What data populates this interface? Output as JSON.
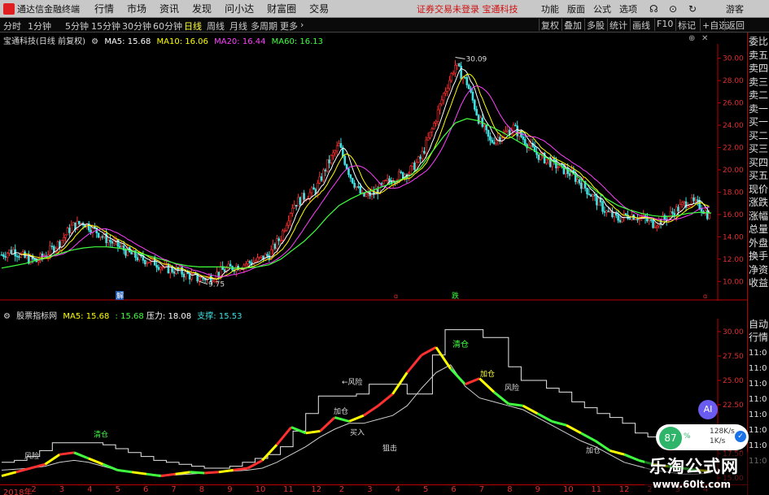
{
  "menubar": {
    "app_name": "通达信金融终端",
    "items": [
      "行情",
      "市场",
      "资讯",
      "发现",
      "问小达",
      "财富圈",
      "交易"
    ],
    "notice": "证券交易未登录  宝通科技",
    "right_items": [
      "功能",
      "版面",
      "公式",
      "选项"
    ],
    "guest": "游客"
  },
  "toolbar": {
    "periods": [
      "分时",
      "1分钟",
      "5分钟",
      "15分钟",
      "30分钟",
      "60分钟",
      "日线",
      "周线",
      "月线",
      "多周期",
      "更多"
    ],
    "active_period": "日线",
    "right_buttons": [
      "复权",
      "叠加",
      "多股",
      "统计",
      "画线",
      "F10",
      "标记",
      "+自选",
      "返回"
    ]
  },
  "main_chart": {
    "info": {
      "title": "宝通科技(日线 前复权)",
      "ma5": "MA5: 15.68",
      "ma10": "MA10: 16.06",
      "ma20": "MA20: 16.44",
      "ma60": "MA60: 16.13"
    },
    "high_label": "30.09",
    "low_label": "9.75",
    "markers": [
      "解",
      "跌"
    ],
    "colors": {
      "ma5": "#ffffff",
      "ma10": "#ffff00",
      "ma20": "#ff40ff",
      "ma60": "#40ff40",
      "up": "#ff3030",
      "down": "#40e0e0"
    }
  },
  "indicator": {
    "info": {
      "name": "股票指标网",
      "ma5": "MA5: 15.68",
      "ma5b": ": 15.68",
      "pressure": "压力: 18.08",
      "support": "支撑: 15.53"
    },
    "signals": [
      "风险",
      "清仓",
      "加仓",
      "买入",
      "狙击",
      "风险",
      "加仓"
    ]
  },
  "chart_data": [
    {
      "type": "line",
      "title": "宝通科技(日线 前复权)",
      "ylim": [
        9,
        31
      ],
      "y_ticks": [
        "30.00",
        "28.00",
        "26.00",
        "24.00",
        "22.00",
        "20.00",
        "18.00",
        "16.00",
        "14.00",
        "12.00",
        "10.00"
      ],
      "series": [
        {
          "name": "收盘",
          "values": [
            12.4,
            12.8,
            12.1,
            11.8,
            12.6,
            13.5,
            14.9,
            15.3,
            14.6,
            13.8,
            13.2,
            12.5,
            12.0,
            11.8,
            11.2,
            11.0,
            10.6,
            10.2,
            10.4,
            11.0,
            11.3,
            11.6,
            11.9,
            12.4,
            14.0,
            16.8,
            17.6,
            18.2,
            20.5,
            22.2,
            19.4,
            17.6,
            17.9,
            18.8,
            19.4,
            19.8,
            21.0,
            23.6,
            26.8,
            29.4,
            27.8,
            24.6,
            22.5,
            23.1,
            23.8,
            22.6,
            21.4,
            20.8,
            20.2,
            19.6,
            18.6,
            17.4,
            16.2,
            15.6,
            16.0,
            15.7,
            15.2,
            15.6,
            16.4,
            17.2,
            16.8,
            15.68
          ]
        },
        {
          "name": "MA60",
          "values": [
            11.2,
            11.4,
            11.6,
            11.9,
            12.2,
            12.5,
            12.8,
            13.0,
            13.1,
            13.1,
            13.0,
            12.8,
            12.5,
            12.2,
            11.9,
            11.6,
            11.4,
            11.3,
            11.3,
            11.3,
            11.2,
            11.2,
            11.3,
            11.5,
            12.0,
            12.8,
            13.6,
            14.6,
            15.8,
            16.8,
            17.4,
            17.9,
            18.2,
            18.6,
            19.0,
            19.4,
            20.2,
            21.6,
            23.0,
            24.2,
            24.6,
            24.4,
            23.9,
            23.4,
            22.8,
            22.2,
            21.6,
            21.0,
            20.4,
            19.8,
            19.0,
            18.2,
            17.4,
            16.8,
            16.4,
            16.1,
            15.9,
            15.8,
            15.9,
            16.1,
            16.2,
            16.13
          ]
        }
      ]
    },
    {
      "type": "line",
      "title": "股票指标网",
      "ylim": [
        15,
        31
      ],
      "y_ticks": [
        "30.00",
        "27.50",
        "25.00",
        "22.50",
        "20.00",
        "17.50",
        "15.00"
      ],
      "series": [
        {
          "name": "压力",
          "values": [
            16.6,
            16.8,
            17.2,
            17.8,
            18.6,
            18.6,
            18.6,
            18.6,
            18.4,
            18.0,
            17.6,
            17.2,
            16.8,
            16.6,
            16.4,
            16.2,
            16.0,
            16.0,
            16.2,
            16.6,
            17.0,
            17.4,
            18.2,
            19.8,
            21.6,
            23.4,
            23.4,
            23.4,
            23.6,
            24.6,
            24.6,
            24.6,
            23.6,
            23.6,
            27.6,
            30.2,
            30.2,
            30.2,
            29.4,
            29.4,
            26.4,
            25.0,
            25.0,
            24.2,
            23.8,
            22.8,
            22.2,
            21.6,
            21.2,
            20.6,
            19.6,
            19.2,
            19.0,
            18.6,
            18.2,
            18.2,
            18.08
          ]
        },
        {
          "name": "支撑",
          "values": [
            15.8,
            15.9,
            16.0,
            16.2,
            16.6,
            16.8,
            16.6,
            16.2,
            15.8,
            15.6,
            15.4,
            15.3,
            15.3,
            15.4,
            15.5,
            15.6,
            15.7,
            15.8,
            16.0,
            16.6,
            17.4,
            18.2,
            19.2,
            20.0,
            20.6,
            20.6,
            21.0,
            21.4,
            22.4,
            24.2,
            25.8,
            26.6,
            24.4,
            23.2,
            22.8,
            22.4,
            22.0,
            21.2,
            20.4,
            19.6,
            18.8,
            18.2,
            17.4,
            16.6,
            16.2,
            15.8,
            15.6,
            15.4,
            15.4,
            15.53
          ]
        },
        {
          "name": "MA5",
          "values": [
            15.2,
            15.6,
            16.0,
            16.4,
            17.4,
            17.6,
            17.0,
            16.4,
            15.8,
            15.6,
            15.4,
            15.2,
            15.4,
            15.6,
            15.5,
            15.6,
            15.8,
            16.0,
            16.8,
            18.4,
            20.2,
            19.6,
            19.8,
            21.2,
            20.8,
            21.4,
            22.4,
            23.6,
            25.8,
            27.6,
            28.4,
            26.2,
            24.6,
            25.2,
            23.8,
            22.6,
            22.4,
            21.6,
            20.8,
            20.4,
            19.6,
            18.8,
            17.8,
            17.4,
            16.8,
            16.4,
            16.2,
            16.0,
            15.8,
            15.68
          ]
        }
      ]
    }
  ],
  "x_axis": {
    "labels": [
      "2018年",
      "2",
      "3",
      "4",
      "5",
      "6",
      "7",
      "8",
      "9",
      "10",
      "11",
      "12",
      "2",
      "3",
      "4",
      "5",
      "6",
      "7",
      "8",
      "9",
      "10",
      "11",
      "12",
      "2",
      "3",
      "4"
    ]
  },
  "right_panel": {
    "items": [
      "委比",
      "卖五",
      "卖四",
      "卖三",
      "卖二",
      "卖一",
      "买一",
      "买二",
      "买三",
      "买四",
      "买五",
      "现价",
      "涨跌",
      "涨幅",
      "总量",
      "外盘",
      "换手",
      "净资",
      "收益",
      "自动",
      "行情"
    ],
    "axis_tail": [
      "11:0",
      "11:0",
      "11:0",
      "11:0",
      "11:0",
      "11:0",
      "11:0",
      "11:0"
    ]
  },
  "overlay": {
    "ai": "AI",
    "net_percent": "87",
    "net_speed_up": "128K/s",
    "net_speed_down": "1K/s",
    "watermark_title": "乐淘公式网",
    "watermark_url": "www.60lt.com"
  }
}
